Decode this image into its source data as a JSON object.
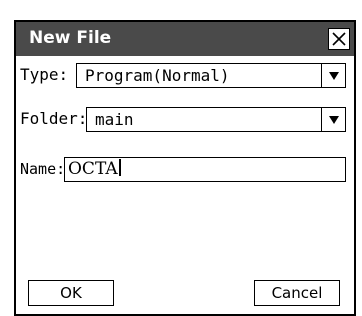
{
  "dialog": {
    "title": "New File",
    "close_icon": "close-x-icon"
  },
  "type_field": {
    "label": "Type:",
    "value": "Program(Normal)",
    "arrow_icon": "dropdown-arrow-icon"
  },
  "folder_field": {
    "label": "Folder:",
    "value": "main",
    "arrow_icon": "dropdown-arrow-icon"
  },
  "name_field": {
    "label": "Name:",
    "value": "OCTA"
  },
  "buttons": {
    "ok": "OK",
    "cancel": "Cancel"
  },
  "colors": {
    "titlebar": "#4a4a4a",
    "title_text": "#ffffff",
    "border": "#000000",
    "background": "#ffffff"
  }
}
